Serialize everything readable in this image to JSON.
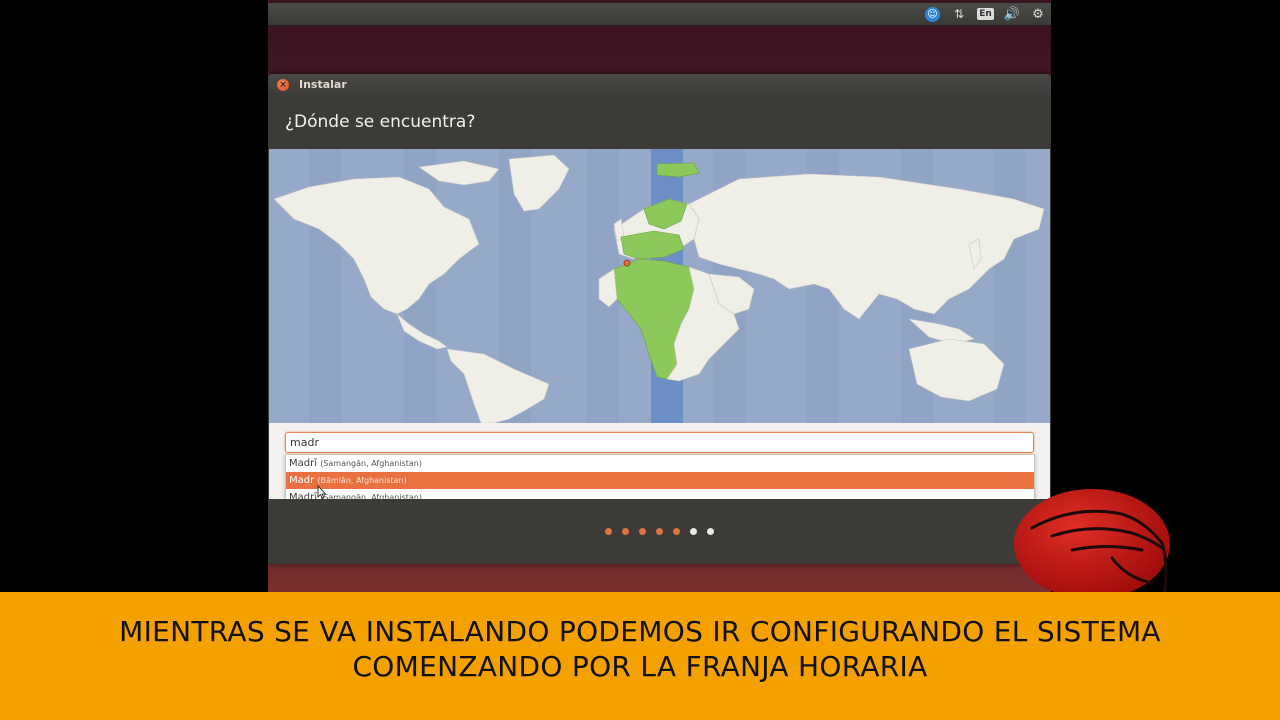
{
  "desktop": {
    "tray": {
      "accessibility_icon": "accessibility-icon",
      "network_icon": "network-arrows-icon",
      "keyboard_layout": "En",
      "sound_icon": "volume-icon",
      "settings_icon": "gear-icon"
    }
  },
  "window": {
    "title": "Instalar",
    "heading": "¿Dónde se encuentra?"
  },
  "location": {
    "input_value": "madr",
    "suggestions": [
      {
        "name": "Madrī",
        "region": "(Samangān, Afghanistan)",
        "selected": false
      },
      {
        "name": "Madr",
        "region": "(Bāmiān, Afghanistan)",
        "selected": true
      },
      {
        "name": "Madrī",
        "region": "(Samangān, Afghanistan)",
        "selected": false
      }
    ]
  },
  "progress": {
    "total_steps": 7,
    "completed_steps": 5
  },
  "caption": {
    "line1": "MIENTRAS SE VA INSTALANDO PODEMOS IR CONFIGURANDO EL SISTEMA",
    "line2": "COMENZANDO POR LA FRANJA HORARIA"
  },
  "colors": {
    "accent": "#e9703f",
    "caption_bg": "#f4a100",
    "map_sea": "#96a9c9",
    "timezone_band": "#6d8fc6",
    "timezone_land": "#8dc85b",
    "land": "#efefe8",
    "logo_red": "#c0100f"
  }
}
